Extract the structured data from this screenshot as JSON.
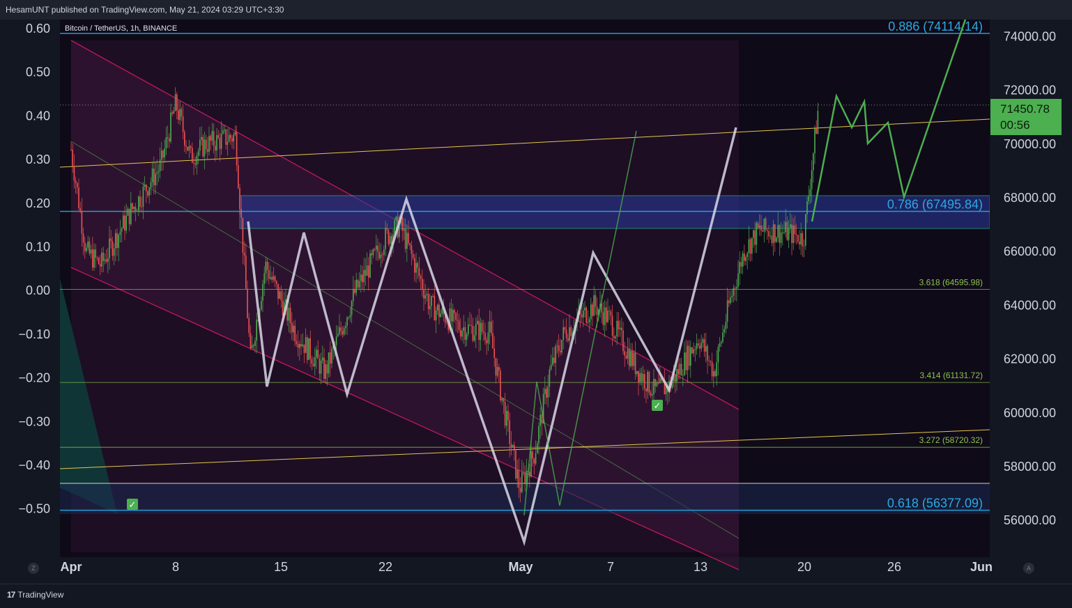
{
  "header": {
    "published_by": "HesamUNT published on TradingView.com, May 21, 2024 03:29 UTC+3:30"
  },
  "symbol_label": "Bitcoin / TetherUS, 1h, BINANCE",
  "footer": {
    "brand": "TradingView"
  },
  "buttons": {
    "left_scale": "Z",
    "auto_scale": "A"
  },
  "price_box": {
    "price": "71450.78",
    "countdown": "00:56",
    "color": "#4caf50"
  },
  "colors": {
    "background": "#131722",
    "up_candle": "#4caf50",
    "down_candle": "#ef5350",
    "fib_blue": "#2aa9e0",
    "fib_green": "#8bc34a",
    "channel": "#e91e63"
  },
  "chart_data": {
    "type": "candlestick",
    "title": "Bitcoin / TetherUS, 1h, BINANCE",
    "interval": "1h",
    "x_ticks": [
      "Apr",
      "8",
      "15",
      "22",
      "May",
      "7",
      "13",
      "20",
      "26",
      "Jun"
    ],
    "y_ticks_right": [
      "56000.00",
      "58000.00",
      "60000.00",
      "62000.00",
      "64000.00",
      "66000.00",
      "68000.00",
      "70000.00",
      "72000.00",
      "74000.00"
    ],
    "y_ticks_left": [
      "0.60",
      "0.50",
      "0.40",
      "0.30",
      "0.20",
      "0.10",
      "0.00",
      "−0.10",
      "−0.20",
      "−0.30",
      "−0.40",
      "−0.50"
    ],
    "ylim": [
      54800,
      75200
    ],
    "last_price": 71450.78,
    "fib_levels": [
      {
        "label": "0.886 (74114.14)",
        "value": 74114.14,
        "color": "#2aa9e0"
      },
      {
        "label": "0.786 (67495.84)",
        "value": 67495.84,
        "color": "#2aa9e0"
      },
      {
        "label": "3.618 (64595.98)",
        "value": 64595.98,
        "color": "#8bc34a"
      },
      {
        "label": "3.414 (61131.72)",
        "value": 61131.72,
        "color": "#8bc34a"
      },
      {
        "label": "3.272 (58720.32)",
        "value": 58720.32,
        "color": "#8bc34a"
      },
      {
        "label": "0.618 (56377.09)",
        "value": 56377.09,
        "color": "#2aa9e0"
      }
    ],
    "price_path": [
      [
        "Apr 1",
        69800
      ],
      [
        "Apr 2",
        66000
      ],
      [
        "Apr 3",
        65500
      ],
      [
        "Apr 5",
        67500
      ],
      [
        "Apr 7",
        69200
      ],
      [
        "Apr 8",
        71500
      ],
      [
        "Apr 9",
        69500
      ],
      [
        "Apr 10",
        70000
      ],
      [
        "Apr 12",
        70300
      ],
      [
        "Apr 13",
        62000
      ],
      [
        "Apr 14",
        65500
      ],
      [
        "Apr 16",
        63000
      ],
      [
        "Apr 18",
        61500
      ],
      [
        "Apr 20",
        64500
      ],
      [
        "Apr 22",
        66500
      ],
      [
        "Apr 23",
        67000
      ],
      [
        "Apr 25",
        64000
      ],
      [
        "Apr 27",
        63200
      ],
      [
        "Apr 29",
        63000
      ],
      [
        "Apr 30",
        60000
      ],
      [
        "May 1",
        57200
      ],
      [
        "May 2",
        58500
      ],
      [
        "May 3",
        61500
      ],
      [
        "May 4",
        63000
      ],
      [
        "May 6",
        64000
      ],
      [
        "May 7",
        63500
      ],
      [
        "May 9",
        61500
      ],
      [
        "May 10",
        60800
      ],
      [
        "May 11",
        61000
      ],
      [
        "May 13",
        62800
      ],
      [
        "May 14",
        61500
      ],
      [
        "May 15",
        64000
      ],
      [
        "May 16",
        66000
      ],
      [
        "May 17",
        66800
      ],
      [
        "May 19",
        66700
      ],
      [
        "May 20",
        66500
      ],
      [
        "May 21",
        71450
      ]
    ]
  }
}
